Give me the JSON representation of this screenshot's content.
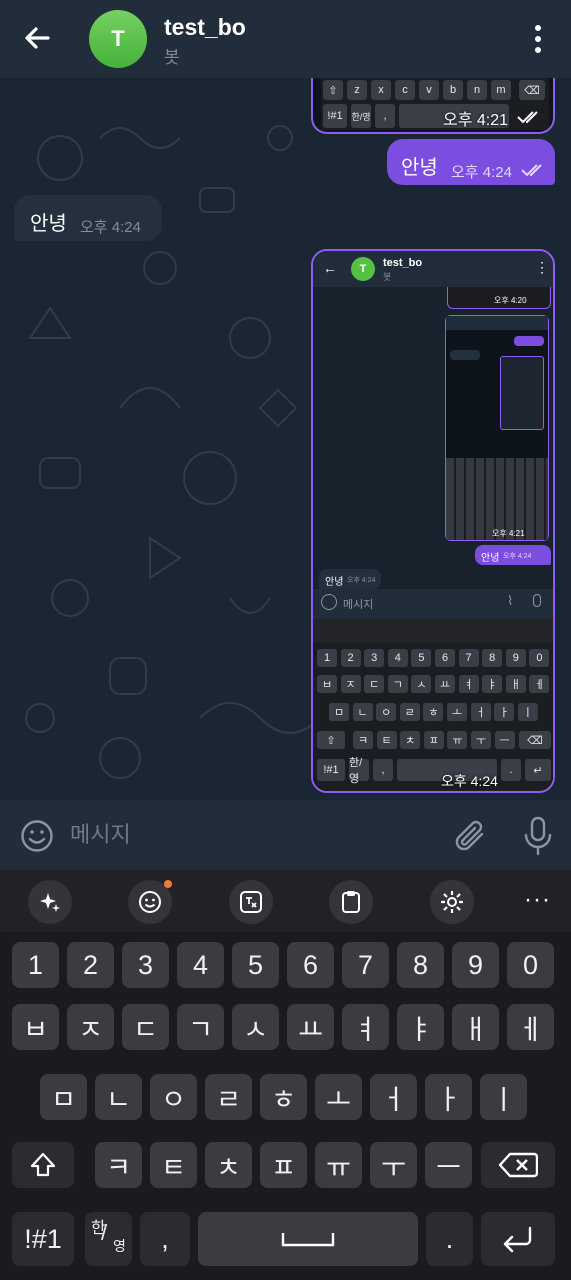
{
  "header": {
    "avatar_letter": "T",
    "title": "test_bo",
    "subtitle": "봇"
  },
  "messages": {
    "top_screenshot_time": "오후 4:21",
    "sent_text": "안녕",
    "sent_time": "오후 4:24",
    "received_text": "안녕",
    "received_time": "오후 4:24"
  },
  "screenshot": {
    "title": "test_bo",
    "subtitle": "봇",
    "avatar_letter": "T",
    "inner_time_1": "오후 4:20",
    "inner_time_2": "오후 4:21",
    "sent_text": "안녕",
    "sent_time": "오후 4:24",
    "received_text": "안녕",
    "received_time": "오후 4:24",
    "input_placeholder": "메시지",
    "bottom_time": "오후 4:24"
  },
  "input": {
    "placeholder": "메시지"
  },
  "keyboard": {
    "numbers": [
      "1",
      "2",
      "3",
      "4",
      "5",
      "6",
      "7",
      "8",
      "9",
      "0"
    ],
    "row1": [
      "ㅂ",
      "ㅈ",
      "ㄷ",
      "ㄱ",
      "ㅅ",
      "ㅛ",
      "ㅕ",
      "ㅑ",
      "ㅐ",
      "ㅔ"
    ],
    "row2": [
      "ㅁ",
      "ㄴ",
      "ㅇ",
      "ㄹ",
      "ㅎ",
      "ㅗ",
      "ㅓ",
      "ㅏ",
      "ㅣ"
    ],
    "row3": [
      "ㅋ",
      "ㅌ",
      "ㅊ",
      "ㅍ",
      "ㅠ",
      "ㅜ",
      "ㅡ"
    ],
    "sym_label": "!#1",
    "lang_top": "한",
    "lang_bottom": "영",
    "comma": ",",
    "period": "."
  },
  "mini_top_row": [
    "z",
    "x",
    "c",
    "v",
    "b",
    "n",
    "m"
  ],
  "icons": {
    "back": "arrow-left-icon",
    "menu": "more-vertical-icon",
    "emoji": "smile-icon",
    "attach": "paperclip-icon",
    "mic": "microphone-icon",
    "ai": "sparkle-icon",
    "sticker": "emoji-sticker-icon",
    "translate": "translate-icon",
    "clipboard": "clipboard-icon",
    "settings": "gear-icon",
    "more": "more-horizontal-icon"
  },
  "colors": {
    "accent": "#7b4ee0",
    "header_bg": "#212d3b",
    "chat_bg": "#1a2633",
    "keyboard_bg": "#1b1b1f",
    "notification_dot": "#f07a3a"
  }
}
